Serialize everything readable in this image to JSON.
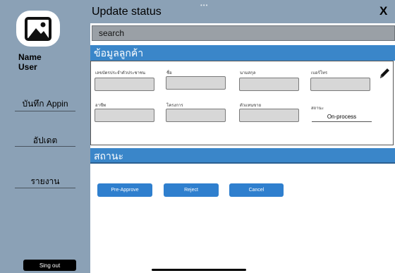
{
  "header": {
    "title": "Update status",
    "close_glyph": "X"
  },
  "search": {
    "placeholder": "search"
  },
  "sidebar": {
    "name_label": "Name",
    "user_label": "User",
    "items": [
      {
        "label": "บันทึก Appin"
      },
      {
        "label": "อัปเดต"
      },
      {
        "label": "รายงาน"
      }
    ],
    "signout_label": "Sing out"
  },
  "customer_section": {
    "title": "ข้อมูลลูกค้า",
    "fields": [
      {
        "label": "เลขบัตรประจำตัวประชาชน",
        "value": ""
      },
      {
        "label": "ชื่อ",
        "value": ""
      },
      {
        "label": "นามสกุล",
        "value": ""
      },
      {
        "label": "เบอร์โทร",
        "value": ""
      },
      {
        "label": "อาชีพ",
        "value": ""
      },
      {
        "label": "โครงการ",
        "value": ""
      },
      {
        "label": "ตัวแทนขาย",
        "value": ""
      }
    ],
    "status_label": "สถานะ",
    "status_value": "On-process"
  },
  "status_section": {
    "title": "สถานะ"
  },
  "actions": {
    "pre_approve": "Pre-Approve",
    "reject": "Reject",
    "cancel": "Cancel"
  },
  "colors": {
    "sidebar": "#8ba1b6",
    "section_bar": "#3a86c9",
    "button": "#2f7fce"
  },
  "icons": [
    "image-icon",
    "close-icon",
    "pencil-icon"
  ]
}
